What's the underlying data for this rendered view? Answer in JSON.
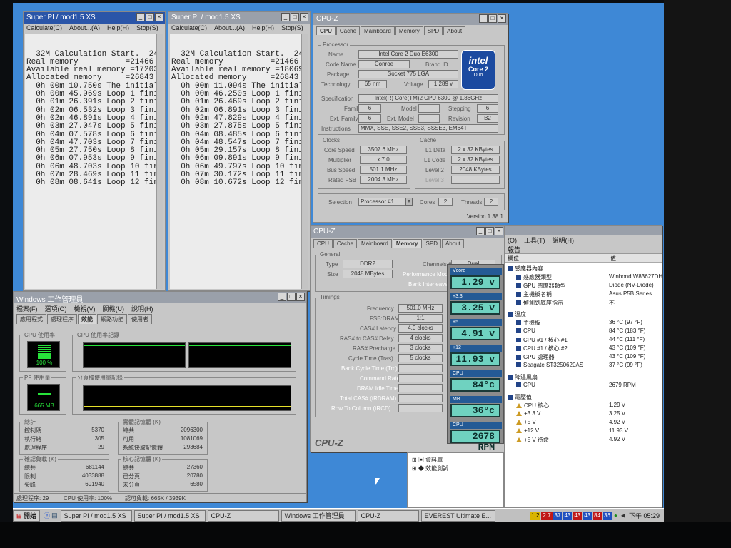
{
  "superpi1": {
    "title": "Super PI / mod1.5 XS",
    "menu": [
      "Calculate(C)",
      "About...(A)",
      "Help(H)",
      "Stop(S)"
    ],
    "lines": [
      "  32M Calculation Start.  24",
      "Real memory          =21466",
      "Available real memory =17203",
      "Allocated memory     =26843",
      "  0h 00m 10.750s The initial",
      "  0h 00m 45.969s Loop 1 fini",
      "  0h 01m 26.391s Loop 2 fini",
      "  0h 02m 06.532s Loop 3 fini",
      "  0h 02m 46.891s Loop 4 fini",
      "  0h 03m 27.047s Loop 5 fini",
      "  0h 04m 07.578s Loop 6 fini",
      "  0h 04m 47.703s Loop 7 fini",
      "  0h 05m 27.750s Loop 8 fini",
      "  0h 06m 07.953s Loop 9 fini",
      "  0h 06m 48.703s Loop 10 fin",
      "  0h 07m 28.469s Loop 11 fin",
      "  0h 08m 08.641s Loop 12 fin"
    ]
  },
  "superpi2": {
    "title": "Super PI / mod1.5 XS",
    "menu": [
      "Calculate(C)",
      "About...(A)",
      "Help(H)",
      "Stop(S)"
    ],
    "lines": [
      "  32M Calculation Start.  24",
      "Real memory          =21466",
      "Available real memory =18069",
      "Allocated memory     =26843",
      "  0h 00m 11.094s The initial",
      "  0h 00m 46.250s Loop 1 fini",
      "  0h 01m 26.469s Loop 2 fini",
      "  0h 02m 06.891s Loop 3 fini",
      "  0h 02m 47.829s Loop 4 fini",
      "  0h 03m 27.875s Loop 5 fini",
      "  0h 04m 08.485s Loop 6 fini",
      "  0h 04m 48.547s Loop 7 fini",
      "  0h 05m 29.157s Loop 8 fini",
      "  0h 06m 09.891s Loop 9 fini",
      "  0h 06m 49.797s Loop 10 fin",
      "  0h 07m 30.172s Loop 11 fin",
      "  0h 08m 10.672s Loop 12 fin"
    ]
  },
  "cpuz_cpu": {
    "title": "CPU-Z",
    "tabs": [
      "CPU",
      "Cache",
      "Mainboard",
      "Memory",
      "SPD",
      "About"
    ],
    "processor_group": "Processor",
    "name_label": "Name",
    "name": "Intel Core 2 Duo E6300",
    "codename_label": "Code Name",
    "codename": "Conroe",
    "brand_id": "Brand ID",
    "package_label": "Package",
    "package": "Socket 775 LGA",
    "technology_label": "Technology",
    "technology": "65 nm",
    "voltage_label": "Voltage",
    "voltage": "1.289 v",
    "spec_label": "Specification",
    "spec": "Intel(R) Core(TM)2 CPU      6300 @ 1.86GHz",
    "family_label": "Family",
    "family": "6",
    "model_label": "Model",
    "model": "F",
    "stepping_label": "Stepping",
    "stepping": "6",
    "extfamily_label": "Ext. Family",
    "extfamily": "6",
    "extmodel_label": "Ext. Model",
    "extmodel": "F",
    "revision_label": "Revision",
    "revision": "B2",
    "instructions_label": "Instructions",
    "instructions": "MMX, SSE, SSE2, SSE3, SSSE3, EM64T",
    "logo_line1": "intel",
    "logo_line2": "Core 2",
    "logo_line3": "Duo",
    "clocks_group": "Clocks",
    "corespeed_label": "Core Speed",
    "corespeed": "3507.6 MHz",
    "multiplier_label": "Multiplier",
    "multiplier": "x 7.0",
    "busspeed_label": "Bus Speed",
    "busspeed": "501.1 MHz",
    "ratedfsb_label": "Rated FSB",
    "ratedfsb": "2004.3 MHz",
    "cache_group": "Cache",
    "l1data_label": "L1 Data",
    "l1data": "2 x 32 KBytes",
    "l1code_label": "L1 Code",
    "l1code": "2 x 32 KBytes",
    "level2_label": "Level 2",
    "level2": "2048 KBytes",
    "level3_label": "Level 3",
    "selection_label": "Selection",
    "selection": "Processor #1",
    "cores_label": "Cores",
    "cores": "2",
    "threads_label": "Threads",
    "threads": "2",
    "version": "Version 1.38.1"
  },
  "cpuz_mem": {
    "title": "CPU-Z",
    "tabs": [
      "CPU",
      "Cache",
      "Mainboard",
      "Memory",
      "SPD",
      "About"
    ],
    "general_group": "General",
    "type_label": "Type",
    "type": "DDR2",
    "size_label": "Size",
    "size": "2048 MBytes",
    "channels_label": "Channels #",
    "channels": "Dual",
    "perfmode_label": "Performance Mode",
    "bankinterleave_label": "Bank Interleave",
    "timings_group": "Timings",
    "frequency_label": "Frequency",
    "frequency": "501.0 MHz",
    "fsbdram_label": "FSB:DRAM",
    "fsbdram": "1:1",
    "cas_label": "CAS# Latency",
    "cas": "4.0 clocks",
    "rcd_label": "RAS# to CAS# Delay",
    "rcd": "4 clocks",
    "rp_label": "RAS# Precharge",
    "rp": "3 clocks",
    "tras_label": "Cycle Time (Tras)",
    "tras": "5 clocks",
    "bank_cycle_label": "Bank Cycle Time (Trc)",
    "cmd_rate_label": "Command Rate",
    "idle_timer_label": "DRAM Idle Timer",
    "total_cas_label": "Total CAS# (tRDRAM)",
    "row_col_label": "Row To Column (tRCD)",
    "footer": "CPU-Z"
  },
  "gadget": {
    "readouts": [
      {
        "label": "Vcore",
        "value": "1.29 v"
      },
      {
        "label": "+3.3",
        "value": "3.25 v"
      },
      {
        "label": "+5",
        "value": "4.91 v"
      },
      {
        "label": "+12",
        "value": "11.93 v"
      },
      {
        "label": "CPU",
        "value": "84°c"
      },
      {
        "label": "MB",
        "value": "36°c"
      },
      {
        "label": "CPU",
        "value": "2678 RPM"
      }
    ]
  },
  "everest": {
    "menu": [
      "(O)",
      "工具(T)",
      "說明(H)"
    ],
    "report": "報告",
    "col_field": "欄位",
    "col_value": "值",
    "rows": [
      {
        "kind": "header",
        "label": "感應器內容"
      },
      {
        "kind": "item",
        "label": "感應器類型",
        "value": "Winbond W83627DH"
      },
      {
        "kind": "item",
        "label": "GPU 感應器類型",
        "value": "Diode (NV-Diode)"
      },
      {
        "kind": "item",
        "label": "主機板名稱",
        "value": "Asus P5B Series"
      },
      {
        "kind": "item",
        "label": "偵測到底座指示",
        "value": "不"
      },
      {
        "kind": "header",
        "label": "溫度"
      },
      {
        "kind": "item",
        "label": "主機板",
        "value": "36 °C (97 °F)"
      },
      {
        "kind": "item",
        "label": "CPU",
        "value": "84 °C (183 °F)"
      },
      {
        "kind": "item",
        "label": "CPU #1 / 核心 #1",
        "value": "44 °C (111 °F)"
      },
      {
        "kind": "item",
        "label": "CPU #1 / 核心 #2",
        "value": "43 °C (109 °F)"
      },
      {
        "kind": "item",
        "label": "GPU 處理器",
        "value": "43 °C (109 °F)"
      },
      {
        "kind": "item",
        "label": "Seagate ST3250620AS",
        "value": "37 °C (99 °F)"
      },
      {
        "kind": "header",
        "label": "降溫風扇"
      },
      {
        "kind": "item",
        "label": "CPU",
        "value": "2679 RPM"
      },
      {
        "kind": "header",
        "label": "電壓值"
      },
      {
        "kind": "warn",
        "label": "CPU 核心",
        "value": "1.29 V"
      },
      {
        "kind": "warn",
        "label": "+3.3 V",
        "value": "3.25 V"
      },
      {
        "kind": "warn",
        "label": "+5 V",
        "value": "4.92 V"
      },
      {
        "kind": "warn",
        "label": "+12 V",
        "value": "11.93 V"
      },
      {
        "kind": "warn",
        "label": "+5 V 待命",
        "value": "4.92 V"
      }
    ],
    "tree_items": [
      "資料庫",
      "效能測試"
    ]
  },
  "taskmgr": {
    "title": "Windows 工作管理員",
    "menu": [
      "檔案(F)",
      "選項(O)",
      "檢視(V)",
      "關機(U)",
      "說明(H)"
    ],
    "tabs": [
      "應用程式",
      "處理程序",
      "效能",
      "網路功能",
      "使用者"
    ],
    "cpu_usage_label": "CPU 使用率",
    "cpu_usage": "100 %",
    "cpu_history_label": "CPU 使用率記錄",
    "pf_usage_label": "PF 使用量",
    "pf_usage": "665 MB",
    "pf_history_label": "分頁檔使用量記錄",
    "totals_label": "總計",
    "handles_label": "控制碼",
    "handles": "5370",
    "threads_label": "執行緒",
    "threads": "305",
    "processes_label": "處理程序",
    "processes": "29",
    "physmem_label": "實體記憶體 (K)",
    "pm_total_label": "總共",
    "pm_total": "2096300",
    "pm_avail_label": "可用",
    "pm_avail": "1081069",
    "pm_cache_label": "系統快取記憶體",
    "pm_cache": "293684",
    "commit_label": "確認負載 (K)",
    "cc_total_label": "總共",
    "cc_total": "681144",
    "cc_limit_label": "限制",
    "cc_limit": "4033888",
    "cc_peak_label": "尖峰",
    "cc_peak": "691940",
    "kernel_label": "核心記憶體 (K)",
    "km_total_label": "總共",
    "km_total": "27360",
    "km_paged_label": "已分頁",
    "km_paged": "20780",
    "km_nonpaged_label": "未分頁",
    "km_nonpaged": "6580",
    "status_processes": "處理程序: 29",
    "status_cpu": "CPU 使用率: 100%",
    "status_commit": "認可負載: 665K / 3939K"
  },
  "taskbar": {
    "start": "開始",
    "buttons": [
      "Super PI / mod1.5 XS",
      "Super PI / mod1.5 XS",
      "CPU-Z",
      "Windows 工作管理員",
      "CPU-Z",
      "EVEREST Ultimate E..."
    ],
    "tray_values": [
      "1.2",
      "2.7",
      "37",
      "43",
      "43",
      "43",
      "84",
      "36"
    ],
    "clock": "下午 05:29"
  }
}
